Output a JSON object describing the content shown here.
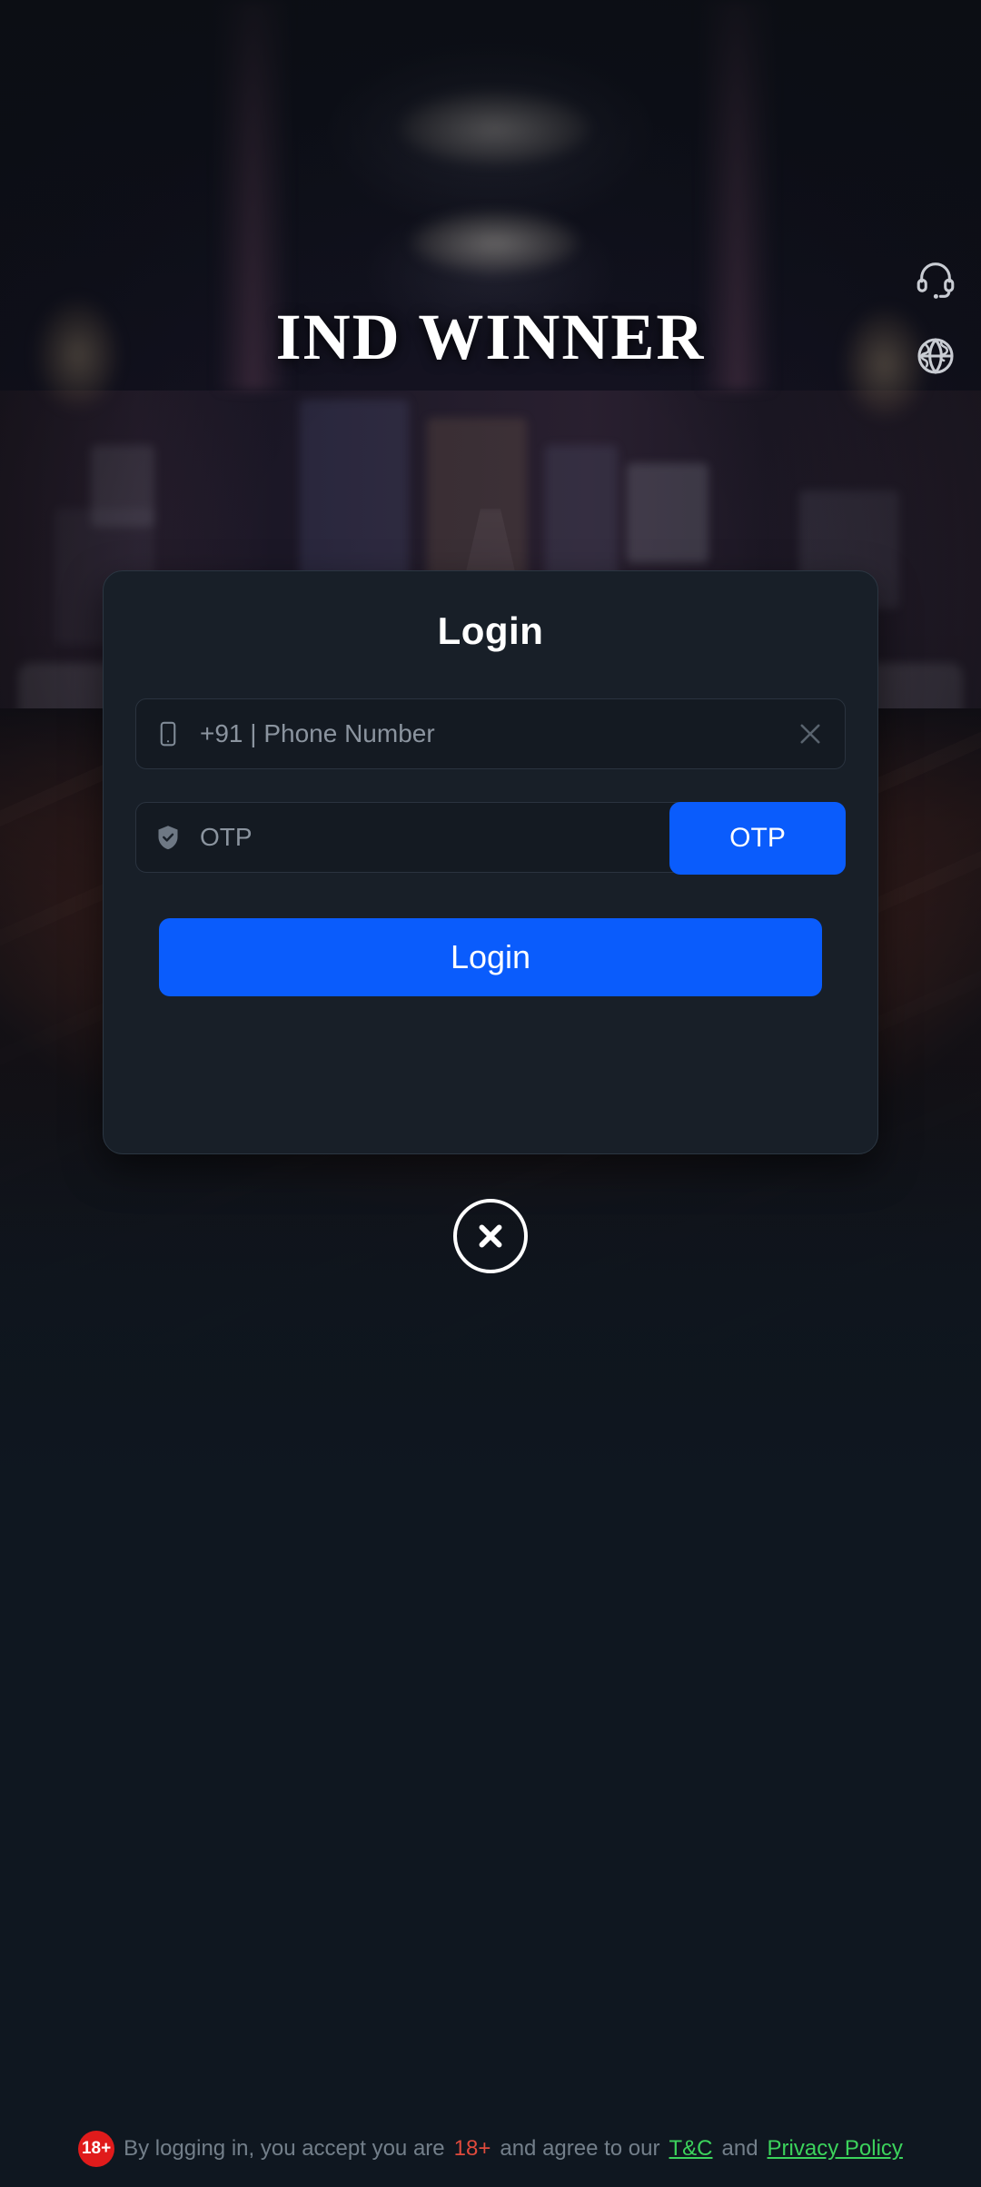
{
  "brand": {
    "title": "IND WINNER"
  },
  "icon_rail": {
    "support": {
      "name": "headset-icon",
      "label": "Customer Support"
    },
    "language": {
      "name": "globe-icon",
      "label": "Language"
    }
  },
  "login_card": {
    "title": "Login",
    "phone_field": {
      "icon": "phone-icon",
      "placeholder": "+91 | Phone Number",
      "value": "",
      "clear_icon": "close-x-icon"
    },
    "otp_field": {
      "icon": "shield-check-icon",
      "placeholder": "OTP",
      "value": "",
      "button_label": "OTP"
    },
    "submit_label": "Login"
  },
  "close_button": {
    "icon": "close-circle-icon",
    "label": "Close"
  },
  "footer": {
    "badge": "18+",
    "text_before": "By logging in, you accept you are",
    "age": "18+",
    "text_middle": "and agree to our",
    "tc_link": "T&C",
    "text_and": "and",
    "privacy_link": "Privacy Policy"
  },
  "colors": {
    "accent_blue": "#0a5cfc",
    "card_bg": "#181f28",
    "field_bg": "#141a22",
    "link_green": "#3cd35c",
    "badge_red": "#e01b1b",
    "page_bg": "#0f1720"
  }
}
